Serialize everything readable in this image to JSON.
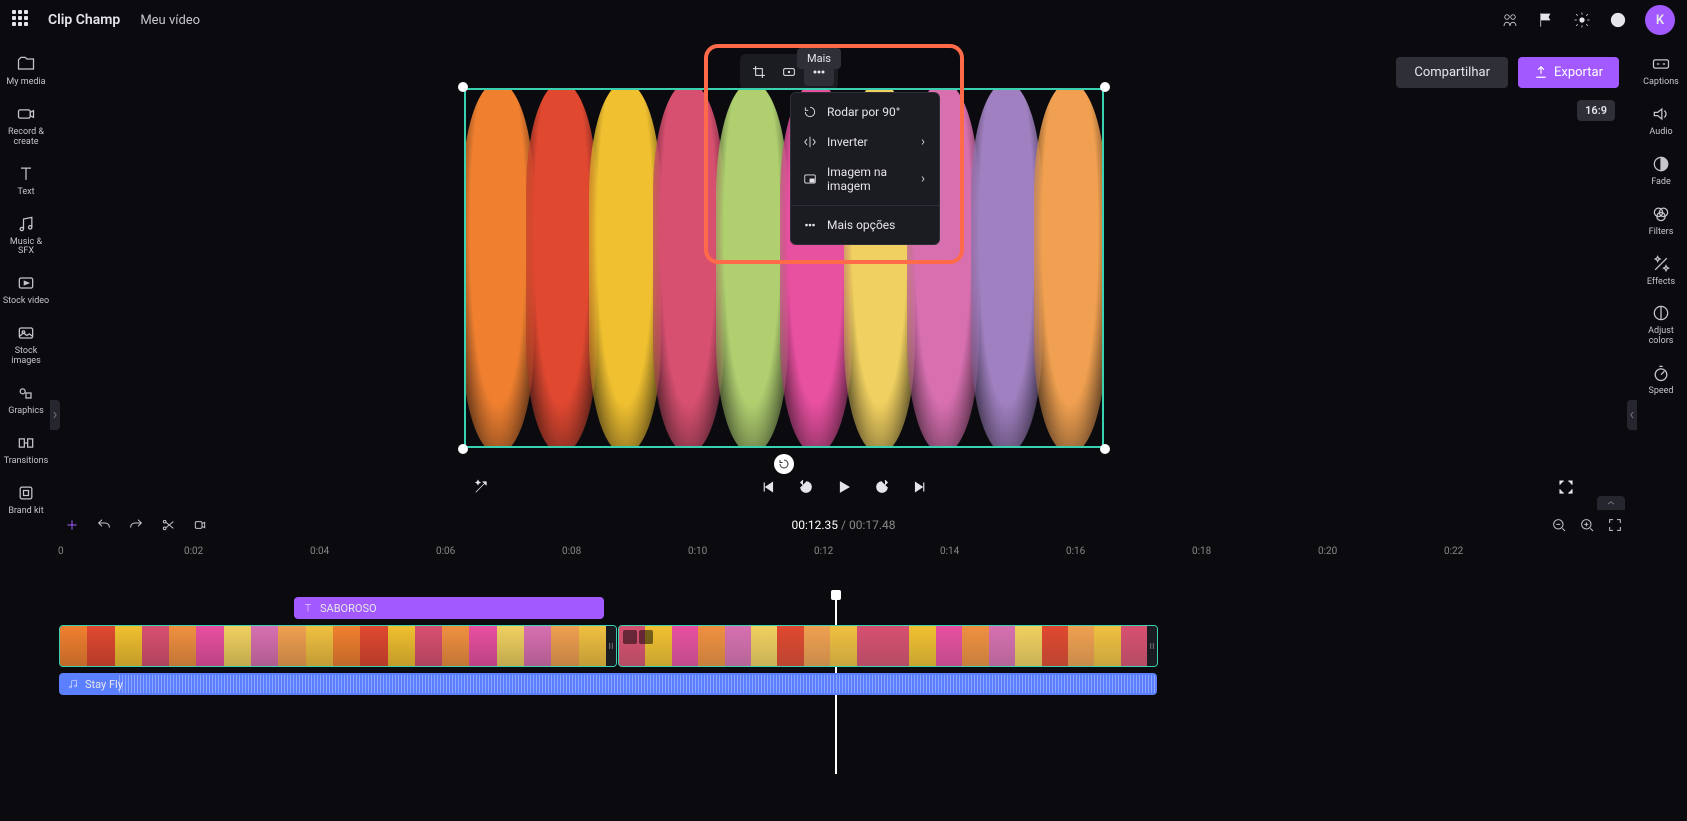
{
  "app": {
    "brand": "Clip Champ",
    "project": "Meu vídeo"
  },
  "avatar": {
    "initial": "K"
  },
  "sidebar_left": [
    {
      "key": "my-media",
      "label": "My media"
    },
    {
      "key": "record-create",
      "label": "Record & create"
    },
    {
      "key": "text",
      "label": "Text"
    },
    {
      "key": "music-sfx",
      "label": "Music & SFX"
    },
    {
      "key": "stock-video",
      "label": "Stock video"
    },
    {
      "key": "stock-images",
      "label": "Stock images"
    },
    {
      "key": "graphics",
      "label": "Graphics"
    },
    {
      "key": "transitions",
      "label": "Transitions"
    },
    {
      "key": "brand-kit",
      "label": "Brand kit"
    }
  ],
  "sidebar_right": [
    {
      "key": "captions",
      "label": "Captions"
    },
    {
      "key": "audio",
      "label": "Audio"
    },
    {
      "key": "fade",
      "label": "Fade"
    },
    {
      "key": "filters",
      "label": "Filters"
    },
    {
      "key": "effects",
      "label": "Effects"
    },
    {
      "key": "adjust-colors",
      "label": "Adjust colors"
    },
    {
      "key": "speed",
      "label": "Speed"
    }
  ],
  "toolbar": {
    "tooltip_more": "Mais",
    "share": "Compartilhar",
    "export": "Exportar",
    "aspect": "16:9"
  },
  "dropdown": {
    "rotate": "Rodar por 90°",
    "flip": "Inverter",
    "pip": "Imagem na imagem",
    "more": "Mais opções"
  },
  "playback": {
    "current": "00:12.35",
    "duration": "00:17.48"
  },
  "ruler": [
    "0",
    "0:02",
    "0:04",
    "0:06",
    "0:08",
    "0:10",
    "0:12",
    "0:14",
    "0:16",
    "0:18",
    "0:20",
    "0:22"
  ],
  "clips": {
    "text_label": "SABOROSO",
    "audio_label": "Stay Fly"
  },
  "thumb_colors_a": [
    "#f08030",
    "#e04830",
    "#f0c030",
    "#d85070",
    "#f09040",
    "#e850a0",
    "#f0d060",
    "#d870b0",
    "#f0a050",
    "#f0c040"
  ],
  "thumb_colors_b": [
    "#d85070",
    "#f0c030",
    "#e850a0",
    "#f09040",
    "#d870b0",
    "#f0d060",
    "#e04830",
    "#f0a050",
    "#f0c040",
    "#d85070"
  ],
  "preview_colors": [
    "#f08030",
    "#e04830",
    "#f0c030",
    "#d85070",
    "#b0d070",
    "#e850a0",
    "#f0d060",
    "#d870b0",
    "#a080c0",
    "#f0a050"
  ]
}
